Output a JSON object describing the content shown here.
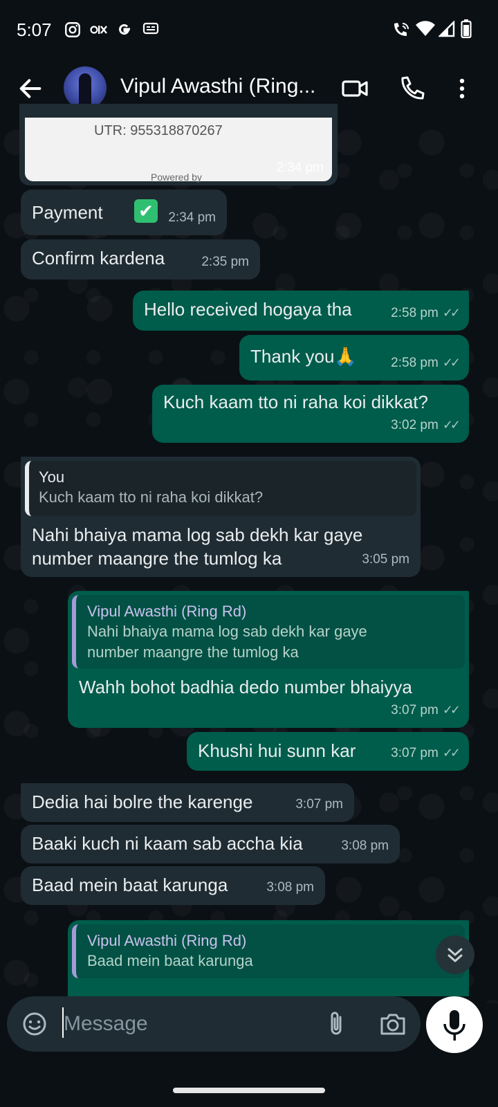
{
  "status_bar": {
    "time": "5:07",
    "left_icons": [
      "instagram-icon",
      "olx-icon",
      "google-icon",
      "message-icon"
    ],
    "right_icons": [
      "wifi-call-icon",
      "wifi-icon",
      "signal-icon",
      "battery-icon"
    ]
  },
  "header": {
    "title": "Vipul Awasthi (Ring...",
    "icons": [
      "back-arrow-icon",
      "video-call-icon",
      "voice-call-icon",
      "more-vert-icon"
    ]
  },
  "image_message": {
    "utr_text": "UTR: 955318870267",
    "powered_text": "Powered by",
    "time": "2:34 pm"
  },
  "messages": [
    {
      "dir": "in",
      "text": "Payment",
      "emoji": "✔",
      "time": "2:34 pm"
    },
    {
      "dir": "in",
      "text": "Confirm kardena",
      "time": "2:35 pm"
    },
    {
      "dir": "out",
      "text": "Hello received hogaya tha",
      "time": "2:58 pm"
    },
    {
      "dir": "out",
      "text": "Thank you🙏",
      "time": "2:58 pm"
    },
    {
      "dir": "out",
      "text": "Kuch kaam tto ni raha koi dikkat?",
      "time": "3:02 pm"
    },
    {
      "dir": "in",
      "quote_author": "You",
      "quote_text": "Kuch kaam tto ni raha koi dikkat?",
      "text_line1": "Nahi bhaiya mama log sab dekh kar gaye",
      "text_line2": "number maangre the tumlog ka",
      "time": "3:05 pm"
    },
    {
      "dir": "out",
      "quote_author": "Vipul Awasthi (Ring Rd)",
      "quote_line1": "Nahi bhaiya mama log sab dekh kar gaye",
      "quote_line2": "number maangre the tumlog ka",
      "text": "Wahh bohot badhia dedo number bhaiyya",
      "time": "3:07 pm"
    },
    {
      "dir": "out",
      "text": "Khushi hui sunn kar",
      "time": "3:07 pm"
    },
    {
      "dir": "in",
      "text": "Dedia hai bolre the karenge",
      "time": "3:07 pm"
    },
    {
      "dir": "in",
      "text": "Baaki kuch ni kaam sab accha kia",
      "time": "3:08 pm"
    },
    {
      "dir": "in",
      "text": "Baad mein baat karunga",
      "time": "3:08 pm"
    },
    {
      "dir": "out",
      "quote_author": "Vipul Awasthi (Ring Rd)",
      "quote_text": "Baad mein baat karunga"
    }
  ],
  "ticks": "✓✓",
  "input": {
    "placeholder": "Message",
    "icons": [
      "emoji-icon",
      "attach-icon",
      "camera-icon",
      "mic-icon"
    ]
  },
  "colors": {
    "incoming_bubble": "#202c33",
    "outgoing_bubble": "#005c4b",
    "background": "#0b1014"
  }
}
